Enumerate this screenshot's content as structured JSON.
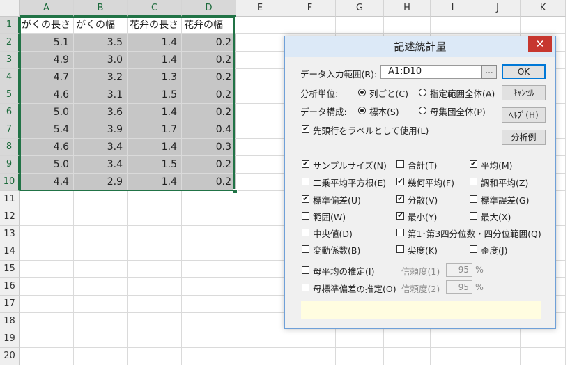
{
  "spreadsheet": {
    "columns": [
      "A",
      "B",
      "C",
      "D",
      "E",
      "F",
      "G",
      "H",
      "I",
      "J",
      "K"
    ],
    "rows": [
      "1",
      "2",
      "3",
      "4",
      "5",
      "6",
      "7",
      "8",
      "9",
      "10",
      "11",
      "12",
      "13",
      "14",
      "15",
      "16",
      "17",
      "18",
      "19",
      "20"
    ],
    "headers": [
      "がくの長さ",
      "がくの幅",
      "花弁の長さ",
      "花弁の幅"
    ],
    "data": [
      [
        "5.1",
        "3.5",
        "1.4",
        "0.2"
      ],
      [
        "4.9",
        "3.0",
        "1.4",
        "0.2"
      ],
      [
        "4.7",
        "3.2",
        "1.3",
        "0.2"
      ],
      [
        "4.6",
        "3.1",
        "1.5",
        "0.2"
      ],
      [
        "5.0",
        "3.6",
        "1.4",
        "0.2"
      ],
      [
        "5.4",
        "3.9",
        "1.7",
        "0.4"
      ],
      [
        "4.6",
        "3.4",
        "1.4",
        "0.3"
      ],
      [
        "5.0",
        "3.4",
        "1.5",
        "0.2"
      ],
      [
        "4.4",
        "2.9",
        "1.4",
        "0.2"
      ]
    ]
  },
  "dialog": {
    "title": "記述統計量",
    "close": "✕",
    "range_label": "データ入力範囲(R):",
    "range_value": "A1:D10",
    "range_browse": "...",
    "ok": "OK",
    "cancel": "ｷｬﾝｾﾙ",
    "help": "ﾍﾙﾌﾟ(H)",
    "example": "分析例",
    "unit_label": "分析単位:",
    "unit_col": "列ごと(C)",
    "unit_all": "指定範囲全体(A)",
    "struct_label": "データ構成:",
    "struct_sample": "標本(S)",
    "struct_pop": "母集団全体(P)",
    "first_row_label": "先頭行をラベルとして使用(L)",
    "check_mark": "✔",
    "stats": {
      "sample_size": "サンプルサイズ(N)",
      "sum": "合計(T)",
      "mean": "平均(M)",
      "rms": "二乗平均平方根(E)",
      "geomean": "幾何平均(F)",
      "harmean": "調和平均(Z)",
      "stdev": "標準偏差(U)",
      "variance": "分散(V)",
      "stderr": "標準誤差(G)",
      "range": "範囲(W)",
      "min": "最小(Y)",
      "max": "最大(X)",
      "median": "中央値(D)",
      "quartile": "第1･第3四分位数・四分位範囲(Q)",
      "cv": "変動係数(B)",
      "kurtosis": "尖度(K)",
      "skewness": "歪度(J)"
    },
    "est_mean": "母平均の推定(I)",
    "est_sd": "母標準偏差の推定(O)",
    "conf1_label": "信頼度(1)",
    "conf2_label": "信頼度(2)",
    "conf1_value": "95",
    "conf2_value": "95",
    "percent": "%"
  },
  "colors": {
    "selection_border": "#217346",
    "selection_fill": "#c6c6c6",
    "close_button": "#c7372f",
    "titlebar": "#dce9f7",
    "message_bar": "#fffde0"
  }
}
